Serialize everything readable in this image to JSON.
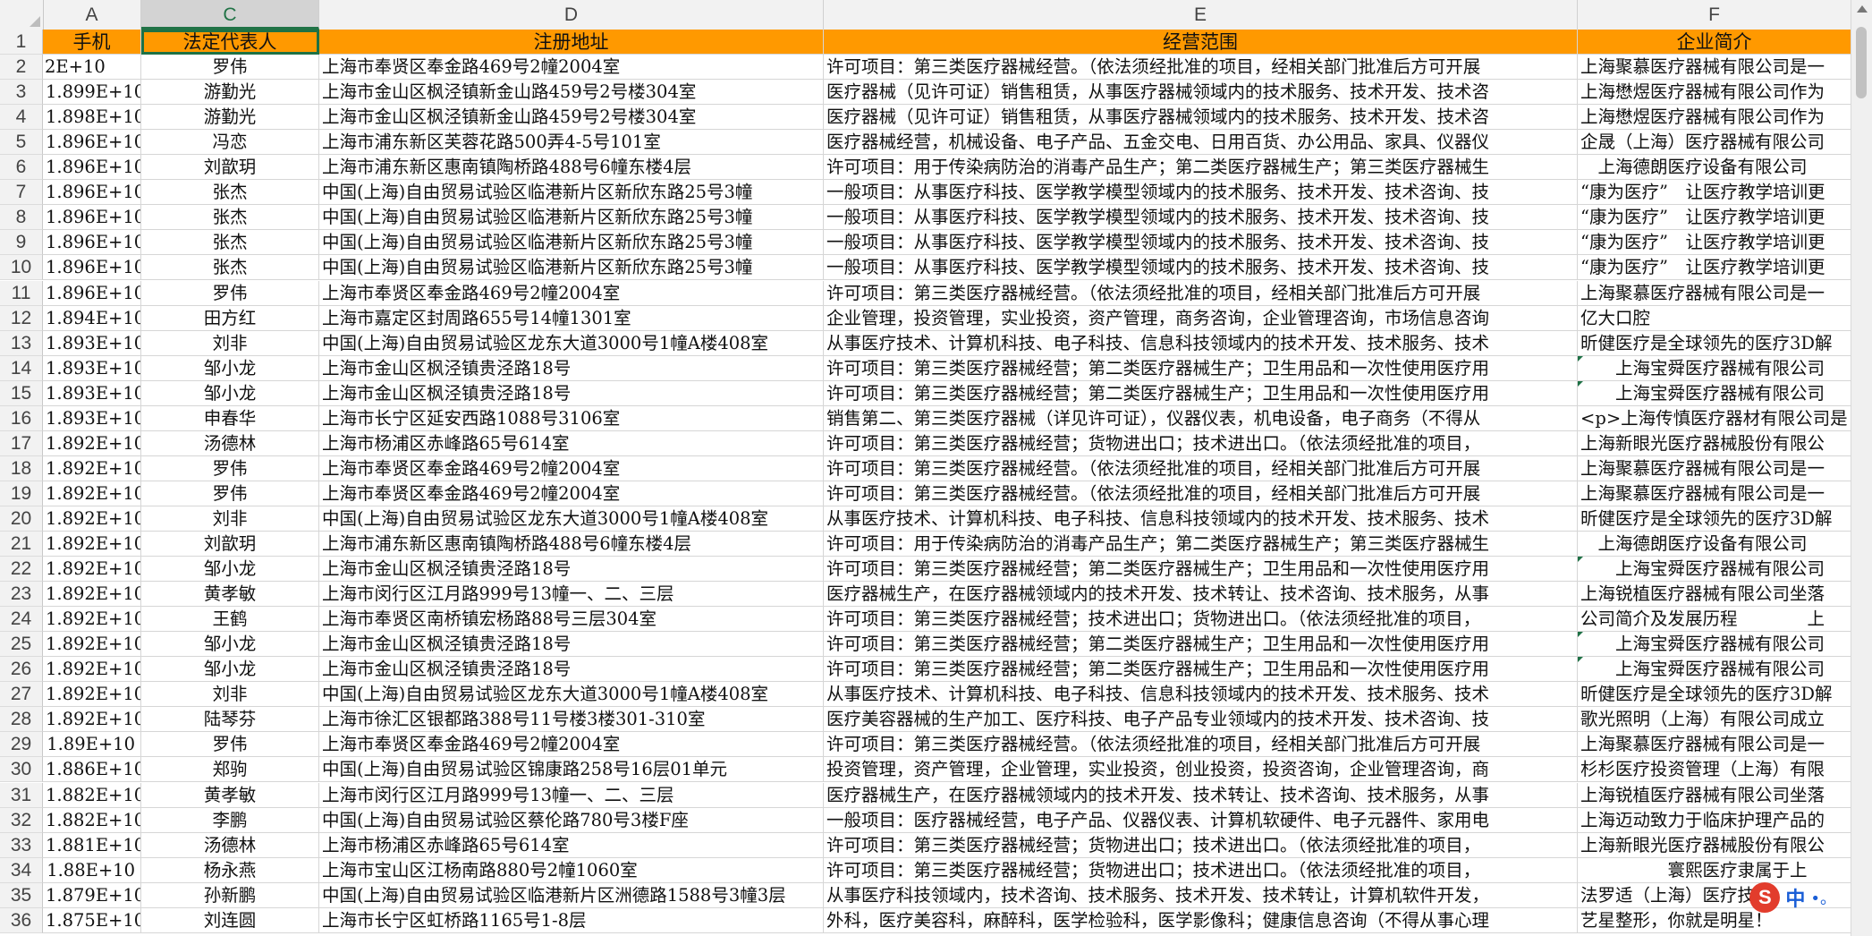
{
  "columns": {
    "a": "A",
    "c": "C",
    "d": "D",
    "e": "E",
    "f": "F"
  },
  "header_row": {
    "num": "1",
    "a": "手机",
    "c": "法定代表人",
    "d": "注册地址",
    "e": "经营范围",
    "f": "企业简介"
  },
  "rows": [
    {
      "num": "2",
      "a": "2E+10",
      "c": "罗伟",
      "d": "上海市奉贤区奉金路469号2幢2004室",
      "e": "许可项目：第三类医疗器械经营。（依法须经批准的项目，经相关部门批准后方可开展",
      "f": "上海聚慕医疗器械有限公司是一"
    },
    {
      "num": "3",
      "a": "1.899E+10",
      "c": "游勤光",
      "d": "上海市金山区枫泾镇新金山路459号2号楼304室",
      "e": "医疗器械（见许可证）销售租赁，从事医疗器械领域内的技术服务、技术开发、技术咨",
      "f": "上海懋煜医疗器械有限公司作为"
    },
    {
      "num": "4",
      "a": "1.898E+10",
      "c": "游勤光",
      "d": "上海市金山区枫泾镇新金山路459号2号楼304室",
      "e": "医疗器械（见许可证）销售租赁，从事医疗器械领域内的技术服务、技术开发、技术咨",
      "f": "上海懋煜医疗器械有限公司作为"
    },
    {
      "num": "5",
      "a": "1.896E+10",
      "c": "冯恋",
      "d": "上海市浦东新区芙蓉花路500弄4-5号101室",
      "e": "医疗器械经营，机械设备、电子产品、五金交电、日用百货、办公用品、家具、仪器仪",
      "f": "企晟（上海）医疗器械有限公司"
    },
    {
      "num": "6",
      "a": "1.896E+10",
      "c": "刘歆玥",
      "d": "上海市浦东新区惠南镇陶桥路488号6幢东楼4层",
      "e": "许可项目：用于传染病防治的消毒产品生产；第二类医疗器械生产；第三类医疗器械生",
      "f": "　上海德朗医疗设备有限公司"
    },
    {
      "num": "7",
      "a": "1.896E+10",
      "c": "张杰",
      "d": "中国(上海)自由贸易试验区临港新片区新欣东路25号3幢",
      "e": "一般项目：从事医疗科技、医学教学模型领域内的技术服务、技术开发、技术咨询、技",
      "f": "“康为医疗”　让医疗教学培训更"
    },
    {
      "num": "8",
      "a": "1.896E+10",
      "c": "张杰",
      "d": "中国(上海)自由贸易试验区临港新片区新欣东路25号3幢",
      "e": "一般项目：从事医疗科技、医学教学模型领域内的技术服务、技术开发、技术咨询、技",
      "f": "“康为医疗”　让医疗教学培训更"
    },
    {
      "num": "9",
      "a": "1.896E+10",
      "c": "张杰",
      "d": "中国(上海)自由贸易试验区临港新片区新欣东路25号3幢",
      "e": "一般项目：从事医疗科技、医学教学模型领域内的技术服务、技术开发、技术咨询、技",
      "f": "“康为医疗”　让医疗教学培训更"
    },
    {
      "num": "10",
      "a": "1.896E+10",
      "c": "张杰",
      "d": "中国(上海)自由贸易试验区临港新片区新欣东路25号3幢",
      "e": "一般项目：从事医疗科技、医学教学模型领域内的技术服务、技术开发、技术咨询、技",
      "f": "“康为医疗”　让医疗教学培训更"
    },
    {
      "num": "11",
      "a": "1.896E+10",
      "c": "罗伟",
      "d": "上海市奉贤区奉金路469号2幢2004室",
      "e": "许可项目：第三类医疗器械经营。（依法须经批准的项目，经相关部门批准后方可开展",
      "f": "上海聚慕医疗器械有限公司是一"
    },
    {
      "num": "12",
      "a": "1.894E+10",
      "c": "田方红",
      "d": "上海市嘉定区封周路655号14幢1301室",
      "e": "企业管理，投资管理，实业投资，资产管理，商务咨询，企业管理咨询，市场信息咨询",
      "f": "亿大口腔"
    },
    {
      "num": "13",
      "a": "1.893E+10",
      "c": "刘非",
      "d": "中国(上海)自由贸易试验区龙东大道3000号1幢A楼408室",
      "e": "从事医疗技术、计算机科技、电子科技、信息科技领域内的技术开发、技术服务、技术",
      "f": "昕健医疗是全球领先的医疗3D解"
    },
    {
      "num": "14",
      "a": "1.893E+10",
      "c": "邹小龙",
      "d": "上海市金山区枫泾镇贵泾路18号",
      "e": "许可项目：第三类医疗器械经营；第二类医疗器械生产；卫生用品和一次性使用医疗用",
      "f": "　　上海宝舜医疗器械有限公司"
    },
    {
      "num": "15",
      "a": "1.893E+10",
      "c": "邹小龙",
      "d": "上海市金山区枫泾镇贵泾路18号",
      "e": "许可项目：第三类医疗器械经营；第二类医疗器械生产；卫生用品和一次性使用医疗用",
      "f": "　　上海宝舜医疗器械有限公司"
    },
    {
      "num": "16",
      "a": "1.893E+10",
      "c": "申春华",
      "d": "上海市长宁区延安西路1088号3106室",
      "e": "销售第二、第三类医疗器械（详见许可证），仪器仪表，机电设备，电子商务（不得从",
      "f": "<p>上海传慎医疗器材有限公司是"
    },
    {
      "num": "17",
      "a": "1.892E+10",
      "c": "汤德林",
      "d": "上海市杨浦区赤峰路65号614室",
      "e": "许可项目：第三类医疗器械经营；货物进出口；技术进出口。（依法须经批准的项目，",
      "f": "上海新眼光医疗器械股份有限公"
    },
    {
      "num": "18",
      "a": "1.892E+10",
      "c": "罗伟",
      "d": "上海市奉贤区奉金路469号2幢2004室",
      "e": "许可项目：第三类医疗器械经营。（依法须经批准的项目，经相关部门批准后方可开展",
      "f": "上海聚慕医疗器械有限公司是一"
    },
    {
      "num": "19",
      "a": "1.892E+10",
      "c": "罗伟",
      "d": "上海市奉贤区奉金路469号2幢2004室",
      "e": "许可项目：第三类医疗器械经营。（依法须经批准的项目，经相关部门批准后方可开展",
      "f": "上海聚慕医疗器械有限公司是一"
    },
    {
      "num": "20",
      "a": "1.892E+10",
      "c": "刘非",
      "d": "中国(上海)自由贸易试验区龙东大道3000号1幢A楼408室",
      "e": "从事医疗技术、计算机科技、电子科技、信息科技领域内的技术开发、技术服务、技术",
      "f": "昕健医疗是全球领先的医疗3D解"
    },
    {
      "num": "21",
      "a": "1.892E+10",
      "c": "刘歆玥",
      "d": "上海市浦东新区惠南镇陶桥路488号6幢东楼4层",
      "e": "许可项目：用于传染病防治的消毒产品生产；第二类医疗器械生产；第三类医疗器械生",
      "f": "　上海德朗医疗设备有限公司"
    },
    {
      "num": "22",
      "a": "1.892E+10",
      "c": "邹小龙",
      "d": "上海市金山区枫泾镇贵泾路18号",
      "e": "许可项目：第三类医疗器械经营；第二类医疗器械生产；卫生用品和一次性使用医疗用",
      "f": "　　上海宝舜医疗器械有限公司"
    },
    {
      "num": "23",
      "a": "1.892E+10",
      "c": "黄孝敏",
      "d": "上海市闵行区江月路999号13幢一、二、三层",
      "e": "医疗器械生产，在医疗器械领域内的技术开发、技术转让、技术咨询、技术服务，从事",
      "f": "上海锐植医疗器械有限公司坐落"
    },
    {
      "num": "24",
      "a": "1.892E+10",
      "c": "王鹤",
      "d": "上海市奉贤区南桥镇宏杨路88号三层304室",
      "e": "许可项目：第三类医疗器械经营；技术进出口；货物进出口。（依法须经批准的项目，",
      "f": "公司简介及发展历程　　　　上"
    },
    {
      "num": "25",
      "a": "1.892E+10",
      "c": "邹小龙",
      "d": "上海市金山区枫泾镇贵泾路18号",
      "e": "许可项目：第三类医疗器械经营；第二类医疗器械生产；卫生用品和一次性使用医疗用",
      "f": "　　上海宝舜医疗器械有限公司"
    },
    {
      "num": "26",
      "a": "1.892E+10",
      "c": "邹小龙",
      "d": "上海市金山区枫泾镇贵泾路18号",
      "e": "许可项目：第三类医疗器械经营；第二类医疗器械生产；卫生用品和一次性使用医疗用",
      "f": "　　上海宝舜医疗器械有限公司"
    },
    {
      "num": "27",
      "a": "1.892E+10",
      "c": "刘非",
      "d": "中国(上海)自由贸易试验区龙东大道3000号1幢A楼408室",
      "e": "从事医疗技术、计算机科技、电子科技、信息科技领域内的技术开发、技术服务、技术",
      "f": "昕健医疗是全球领先的医疗3D解"
    },
    {
      "num": "28",
      "a": "1.892E+10",
      "c": "陆琴芬",
      "d": "上海市徐汇区银都路388号11号楼3楼301-310室",
      "e": "医疗美容器械的生产加工、医疗科技、电子产品专业领域内的技术开发、技术咨询、技",
      "f": "歌光照明（上海）有限公司成立"
    },
    {
      "num": "29",
      "a": "1.89E+10",
      "c": "罗伟",
      "d": "上海市奉贤区奉金路469号2幢2004室",
      "e": "许可项目：第三类医疗器械经营。（依法须经批准的项目，经相关部门批准后方可开展",
      "f": "上海聚慕医疗器械有限公司是一"
    },
    {
      "num": "30",
      "a": "1.886E+10",
      "c": "郑驹",
      "d": "中国(上海)自由贸易试验区锦康路258号16层01单元",
      "e": "投资管理，资产管理，企业管理，实业投资，创业投资，投资咨询，企业管理咨询，商",
      "f": "杉杉医疗投资管理（上海）有限"
    },
    {
      "num": "31",
      "a": "1.882E+10",
      "c": "黄孝敏",
      "d": "上海市闵行区江月路999号13幢一、二、三层",
      "e": "医疗器械生产，在医疗器械领域内的技术开发、技术转让、技术咨询、技术服务，从事",
      "f": "上海锐植医疗器械有限公司坐落"
    },
    {
      "num": "32",
      "a": "1.882E+10",
      "c": "李鹏",
      "d": "中国(上海)自由贸易试验区蔡伦路780号3楼F座",
      "e": "一般项目：医疗器械经营，电子产品、仪器仪表、计算机软硬件、电子元器件、家用电",
      "f": "上海迈动致力于临床护理产品的"
    },
    {
      "num": "33",
      "a": "1.881E+10",
      "c": "汤德林",
      "d": "上海市杨浦区赤峰路65号614室",
      "e": "许可项目：第三类医疗器械经营；货物进出口；技术进出口。（依法须经批准的项目，",
      "f": "上海新眼光医疗器械股份有限公"
    },
    {
      "num": "34",
      "a": "1.88E+10",
      "c": "杨永燕",
      "d": "上海市宝山区江杨南路880号2幢1060室",
      "e": "许可项目：第三类医疗器械经营；货物进出口；技术进出口。（依法须经批准的项目，",
      "f": "　　　　　寰熙医疗隶属于上"
    },
    {
      "num": "35",
      "a": "1.879E+10",
      "c": "孙新鹏",
      "d": "中国(上海)自由贸易试验区临港新片区洲德路1588号3幢3层",
      "e": "从事医疗科技领域内，技术咨询、技术服务、技术开发、技术转让，计算机软件开发，",
      "f": "法罗适（上海）医疗技术"
    },
    {
      "num": "36",
      "a": "1.875E+10",
      "c": "刘连圆",
      "d": "上海市长宁区虹桥路1165号1-8层",
      "e": "外科，医疗美容科，麻醉科，医学检验科，医学影像科；健康信息咨询（不得从事心理",
      "f": "艺星整形，你就是明星！"
    }
  ],
  "ime": {
    "logo": "S",
    "label": "中",
    "extra": "•。"
  },
  "colors": {
    "header_fill": "#ff9900",
    "selection": "#1e7145"
  }
}
